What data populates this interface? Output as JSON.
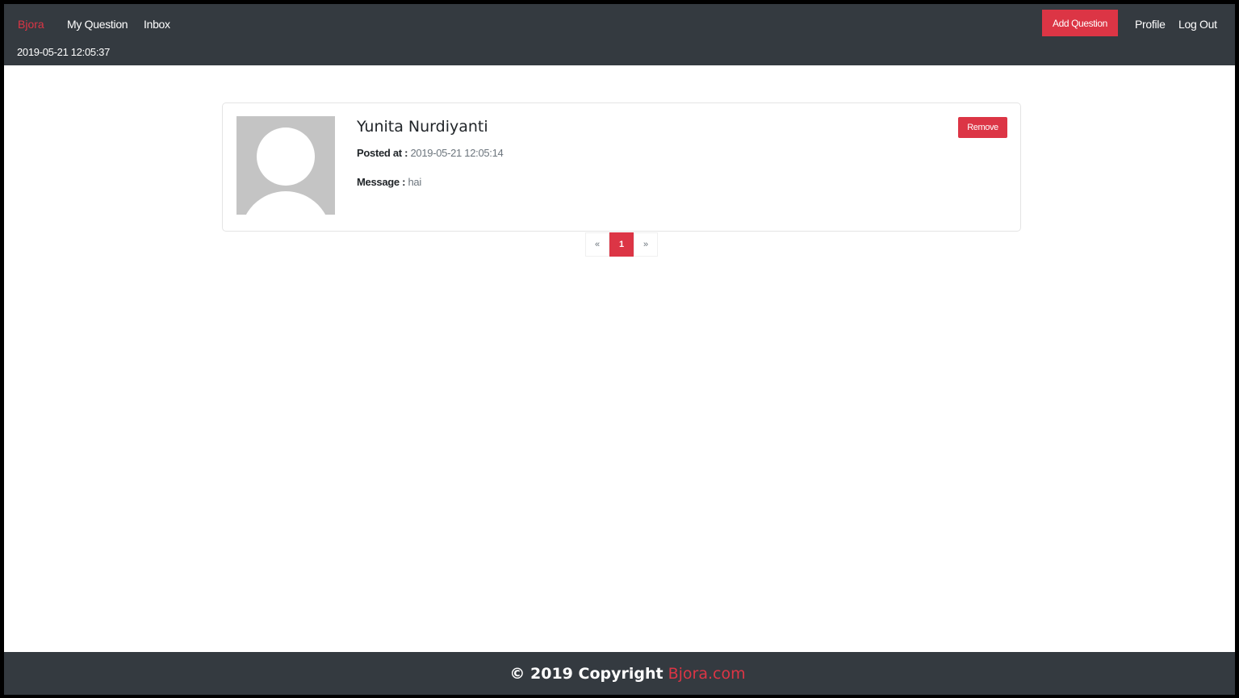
{
  "navbar": {
    "brand": "Bjora",
    "links": [
      "My Question",
      "Inbox"
    ],
    "datetime": "2019-05-21 12:05:37",
    "add_question_label": "Add Question",
    "profile_label": "Profile",
    "logout_label": "Log Out"
  },
  "message": {
    "name": "Yunita Nurdiyanti",
    "posted_label": "Posted at :",
    "posted_value": "2019-05-21 12:05:14",
    "message_label": "Message :",
    "message_value": "hai",
    "remove_label": "Remove"
  },
  "pagination": {
    "prev": "«",
    "pages": [
      "1"
    ],
    "next": "»",
    "current": 1
  },
  "footer": {
    "copyright": "© 2019 Copyright",
    "site": "Bjora.com"
  },
  "colors": {
    "accent": "#dc3545",
    "navbar_bg": "#343a40",
    "avatar_bg": "#c4c4c4"
  }
}
